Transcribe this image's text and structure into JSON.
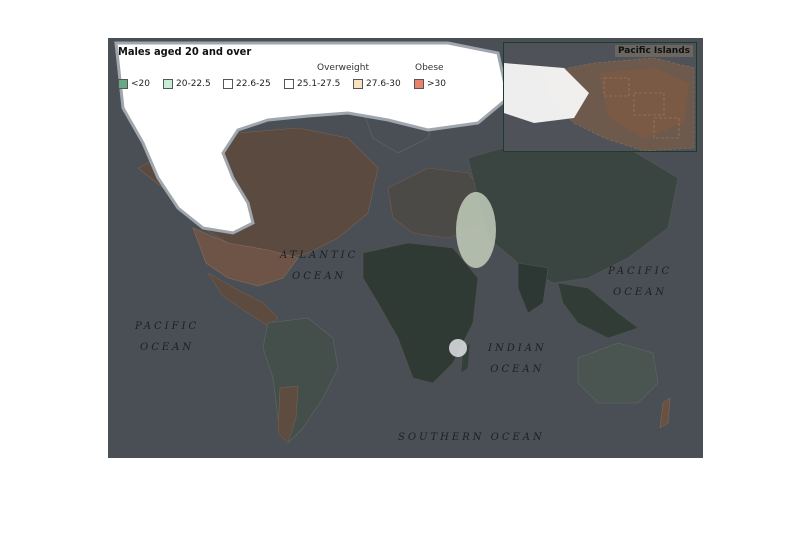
{
  "legend": {
    "title": "Males aged 20 and over",
    "overweight_label": "Overweight",
    "obese_label": "Obese",
    "items": [
      {
        "label": "<20",
        "color": "#6aa883"
      },
      {
        "label": "20-22.5",
        "color": "#c9ecd6"
      },
      {
        "label": "22.6-25",
        "color": "#ffffff"
      },
      {
        "label": "25.1-27.5",
        "color": "#ffffff"
      },
      {
        "label": "27.6-30",
        "color": "#f7e3c0"
      },
      {
        "label": ">30",
        "color": "#e9826b"
      }
    ]
  },
  "oceans": {
    "atlantic": [
      "ATLANTIC",
      "OCEAN"
    ],
    "pacific_west": [
      "PACIFIC",
      "OCEAN"
    ],
    "pacific_east": [
      "PACIFIC",
      "OCEAN"
    ],
    "indian": [
      "INDIAN",
      "OCEAN"
    ],
    "southern": "SOUTHERN OCEAN"
  },
  "inset": {
    "title": "Pacific Islands"
  },
  "colors": {
    "ocean": "#4a4f55",
    "low_bmi": "#2f3d38",
    "mid_bmi": "#3f4a47",
    "high_bmi": "#6e5a4c",
    "obese": "#7a5644"
  }
}
